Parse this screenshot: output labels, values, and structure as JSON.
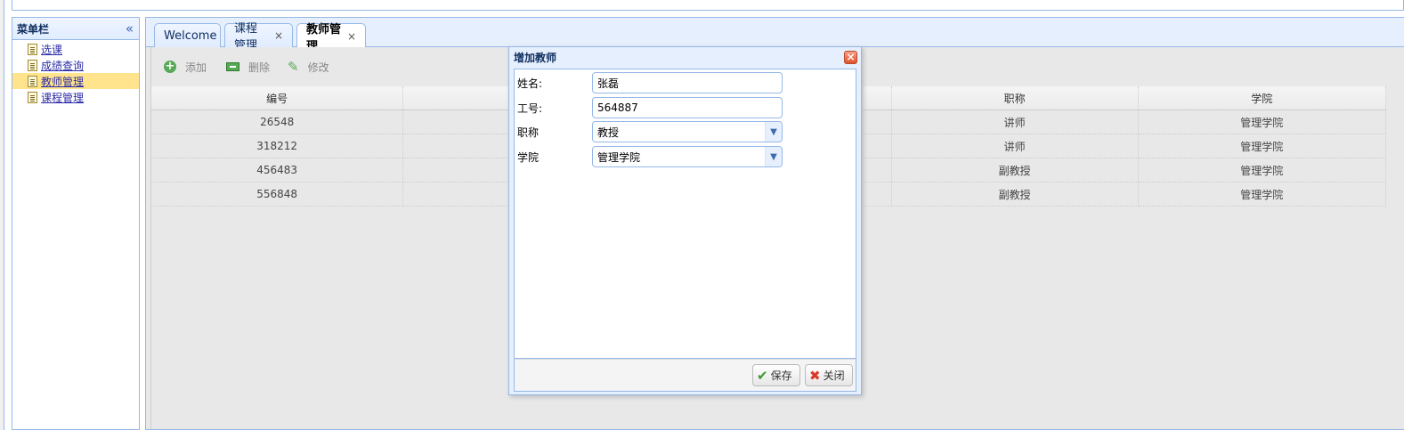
{
  "sidebar": {
    "title": "菜单栏",
    "items": [
      {
        "label": "选课"
      },
      {
        "label": "成绩查询"
      },
      {
        "label": "教师管理"
      },
      {
        "label": "课程管理"
      }
    ]
  },
  "tabs": [
    {
      "label": "Welcome"
    },
    {
      "label": "课程管理",
      "close": "×"
    },
    {
      "label": "教师管理",
      "close": "×"
    }
  ],
  "toolbar": {
    "add": "添加",
    "delete": "删除",
    "edit": "修改"
  },
  "grid": {
    "columns": [
      "编号",
      "",
      "",
      "职称",
      "学院"
    ],
    "rows": [
      [
        "26548",
        "",
        "",
        "讲师",
        "管理学院"
      ],
      [
        "318212",
        "",
        "",
        "讲师",
        "管理学院"
      ],
      [
        "456483",
        "",
        "",
        "副教授",
        "管理学院"
      ],
      [
        "556848",
        "",
        "",
        "副教授",
        "管理学院"
      ]
    ]
  },
  "dialog": {
    "title": "增加教师",
    "fields": {
      "name_label": "姓名:",
      "name_value": "张磊",
      "id_label": "工号:",
      "id_value": "564887",
      "title_label": "职称",
      "title_value": "教授",
      "college_label": "学院",
      "college_value": "管理学院"
    },
    "save_label": "保存",
    "close_label": "关闭"
  }
}
